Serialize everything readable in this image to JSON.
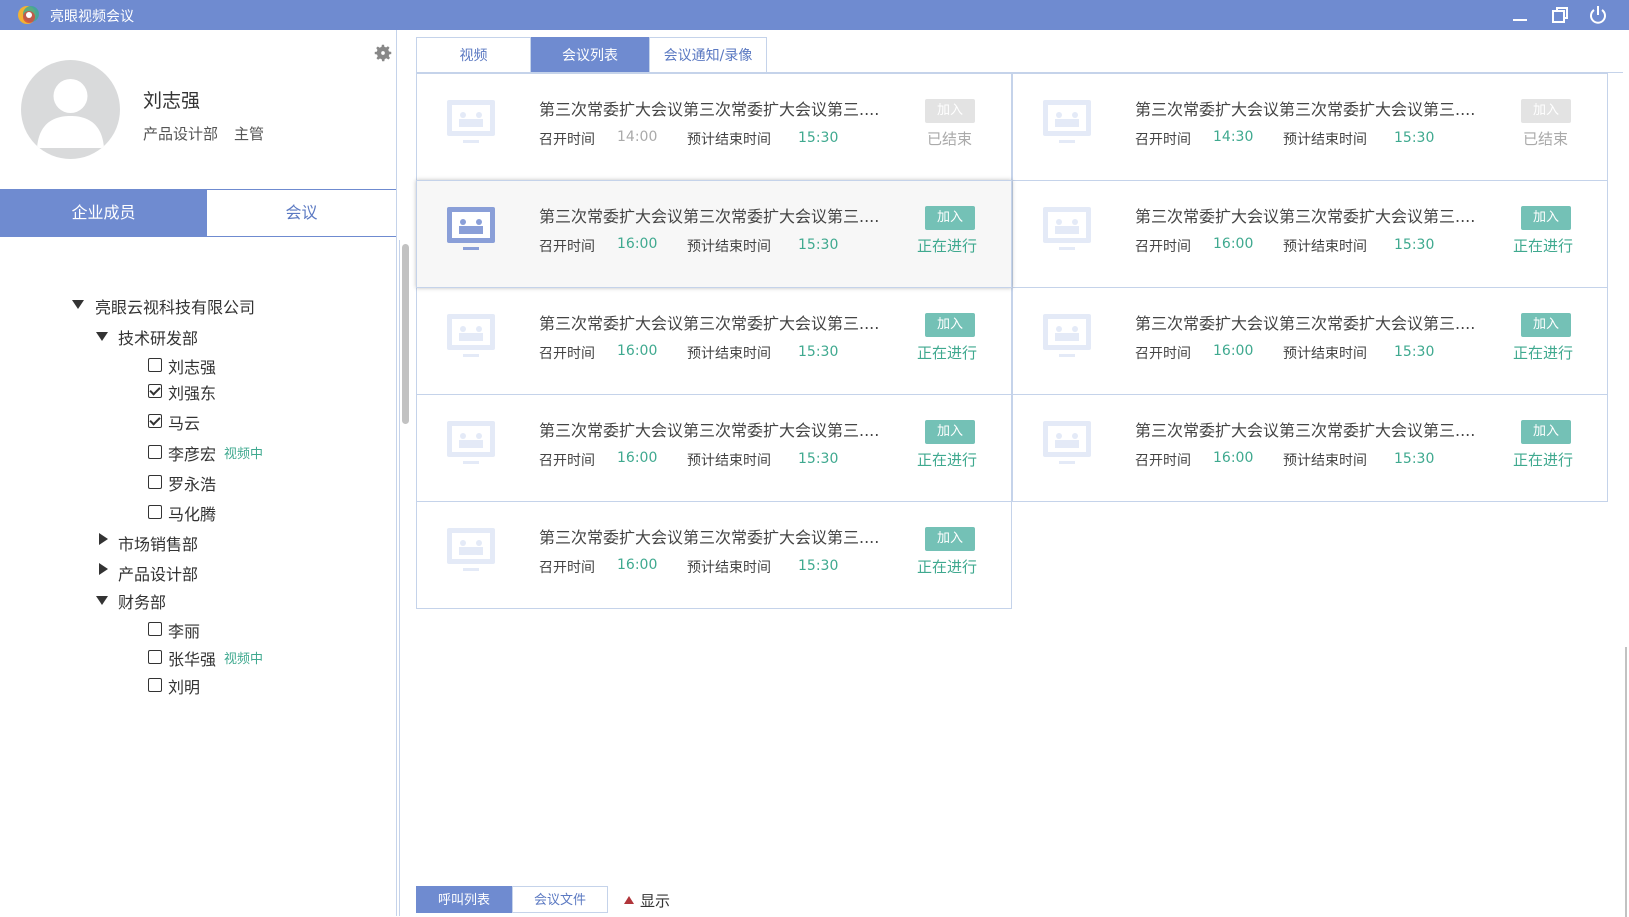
{
  "app": {
    "title": "亮眼视频会议",
    "colors": {
      "accent": "#6f8bd0",
      "green": "#3fa98f",
      "join": "#74c1b6",
      "border": "#c5d3ea"
    }
  },
  "user": {
    "name": "刘志强",
    "department": "产品设计部",
    "role": "主管"
  },
  "left_tabs": {
    "members": "企业成员",
    "meetings": "会议"
  },
  "tree": {
    "company": "亮眼云视科技有限公司",
    "departments": [
      {
        "name": "技术研发部",
        "expanded": true,
        "members": [
          {
            "name": "刘志强",
            "checked": false,
            "tag": ""
          },
          {
            "name": "刘强东",
            "checked": true,
            "tag": ""
          },
          {
            "name": "马云",
            "checked": true,
            "tag": ""
          },
          {
            "name": "李彦宏",
            "checked": false,
            "tag": "视频中"
          },
          {
            "name": "罗永浩",
            "checked": false,
            "tag": ""
          },
          {
            "name": "马化腾",
            "checked": false,
            "tag": ""
          }
        ]
      },
      {
        "name": "市场销售部",
        "expanded": false,
        "members": []
      },
      {
        "name": "产品设计部",
        "expanded": false,
        "members": []
      },
      {
        "name": "财务部",
        "expanded": true,
        "members": [
          {
            "name": "李丽",
            "checked": false,
            "tag": ""
          },
          {
            "name": "张华强",
            "checked": false,
            "tag": "视频中"
          },
          {
            "name": "刘明",
            "checked": false,
            "tag": ""
          }
        ]
      }
    ]
  },
  "right_tabs": [
    "视频",
    "会议列表",
    "会议通知/录像"
  ],
  "labels": {
    "start": "召开时间",
    "end": "预计结束时间",
    "join": "加入"
  },
  "meetings": [
    {
      "title": "第三次常委扩大会议第三次常委扩大会议第三....",
      "start": "14:00",
      "end": "15:30",
      "status": "已结束",
      "ended": true
    },
    {
      "title": "第三次常委扩大会议第三次常委扩大会议第三....",
      "start": "14:30",
      "end": "15:30",
      "status": "已结束",
      "ended": true
    },
    {
      "title": "第三次常委扩大会议第三次常委扩大会议第三....",
      "start": "16:00",
      "end": "15:30",
      "status": "正在进行",
      "ended": false
    },
    {
      "title": "第三次常委扩大会议第三次常委扩大会议第三....",
      "start": "16:00",
      "end": "15:30",
      "status": "正在进行",
      "ended": false
    },
    {
      "title": "第三次常委扩大会议第三次常委扩大会议第三....",
      "start": "16:00",
      "end": "15:30",
      "status": "正在进行",
      "ended": false
    },
    {
      "title": "第三次常委扩大会议第三次常委扩大会议第三....",
      "start": "16:00",
      "end": "15:30",
      "status": "正在进行",
      "ended": false
    },
    {
      "title": "第三次常委扩大会议第三次常委扩大会议第三....",
      "start": "16:00",
      "end": "15:30",
      "status": "正在进行",
      "ended": false
    },
    {
      "title": "第三次常委扩大会议第三次常委扩大会议第三....",
      "start": "16:00",
      "end": "15:30",
      "status": "正在进行",
      "ended": false
    },
    {
      "title": "第三次常委扩大会议第三次常委扩大会议第三....",
      "start": "16:00",
      "end": "15:30",
      "status": "正在进行",
      "ended": false
    }
  ],
  "bottom_tabs": {
    "call_list": "呼叫列表",
    "meeting_files": "会议文件"
  },
  "show_toggle": "显示",
  "icons": {
    "logo": "app-logo-icon",
    "minimize": "minimize-icon",
    "restore": "restore-icon",
    "power": "power-icon",
    "settings": "gear-icon",
    "avatar": "user-avatar-icon",
    "meeting": "monitor-meeting-icon"
  }
}
